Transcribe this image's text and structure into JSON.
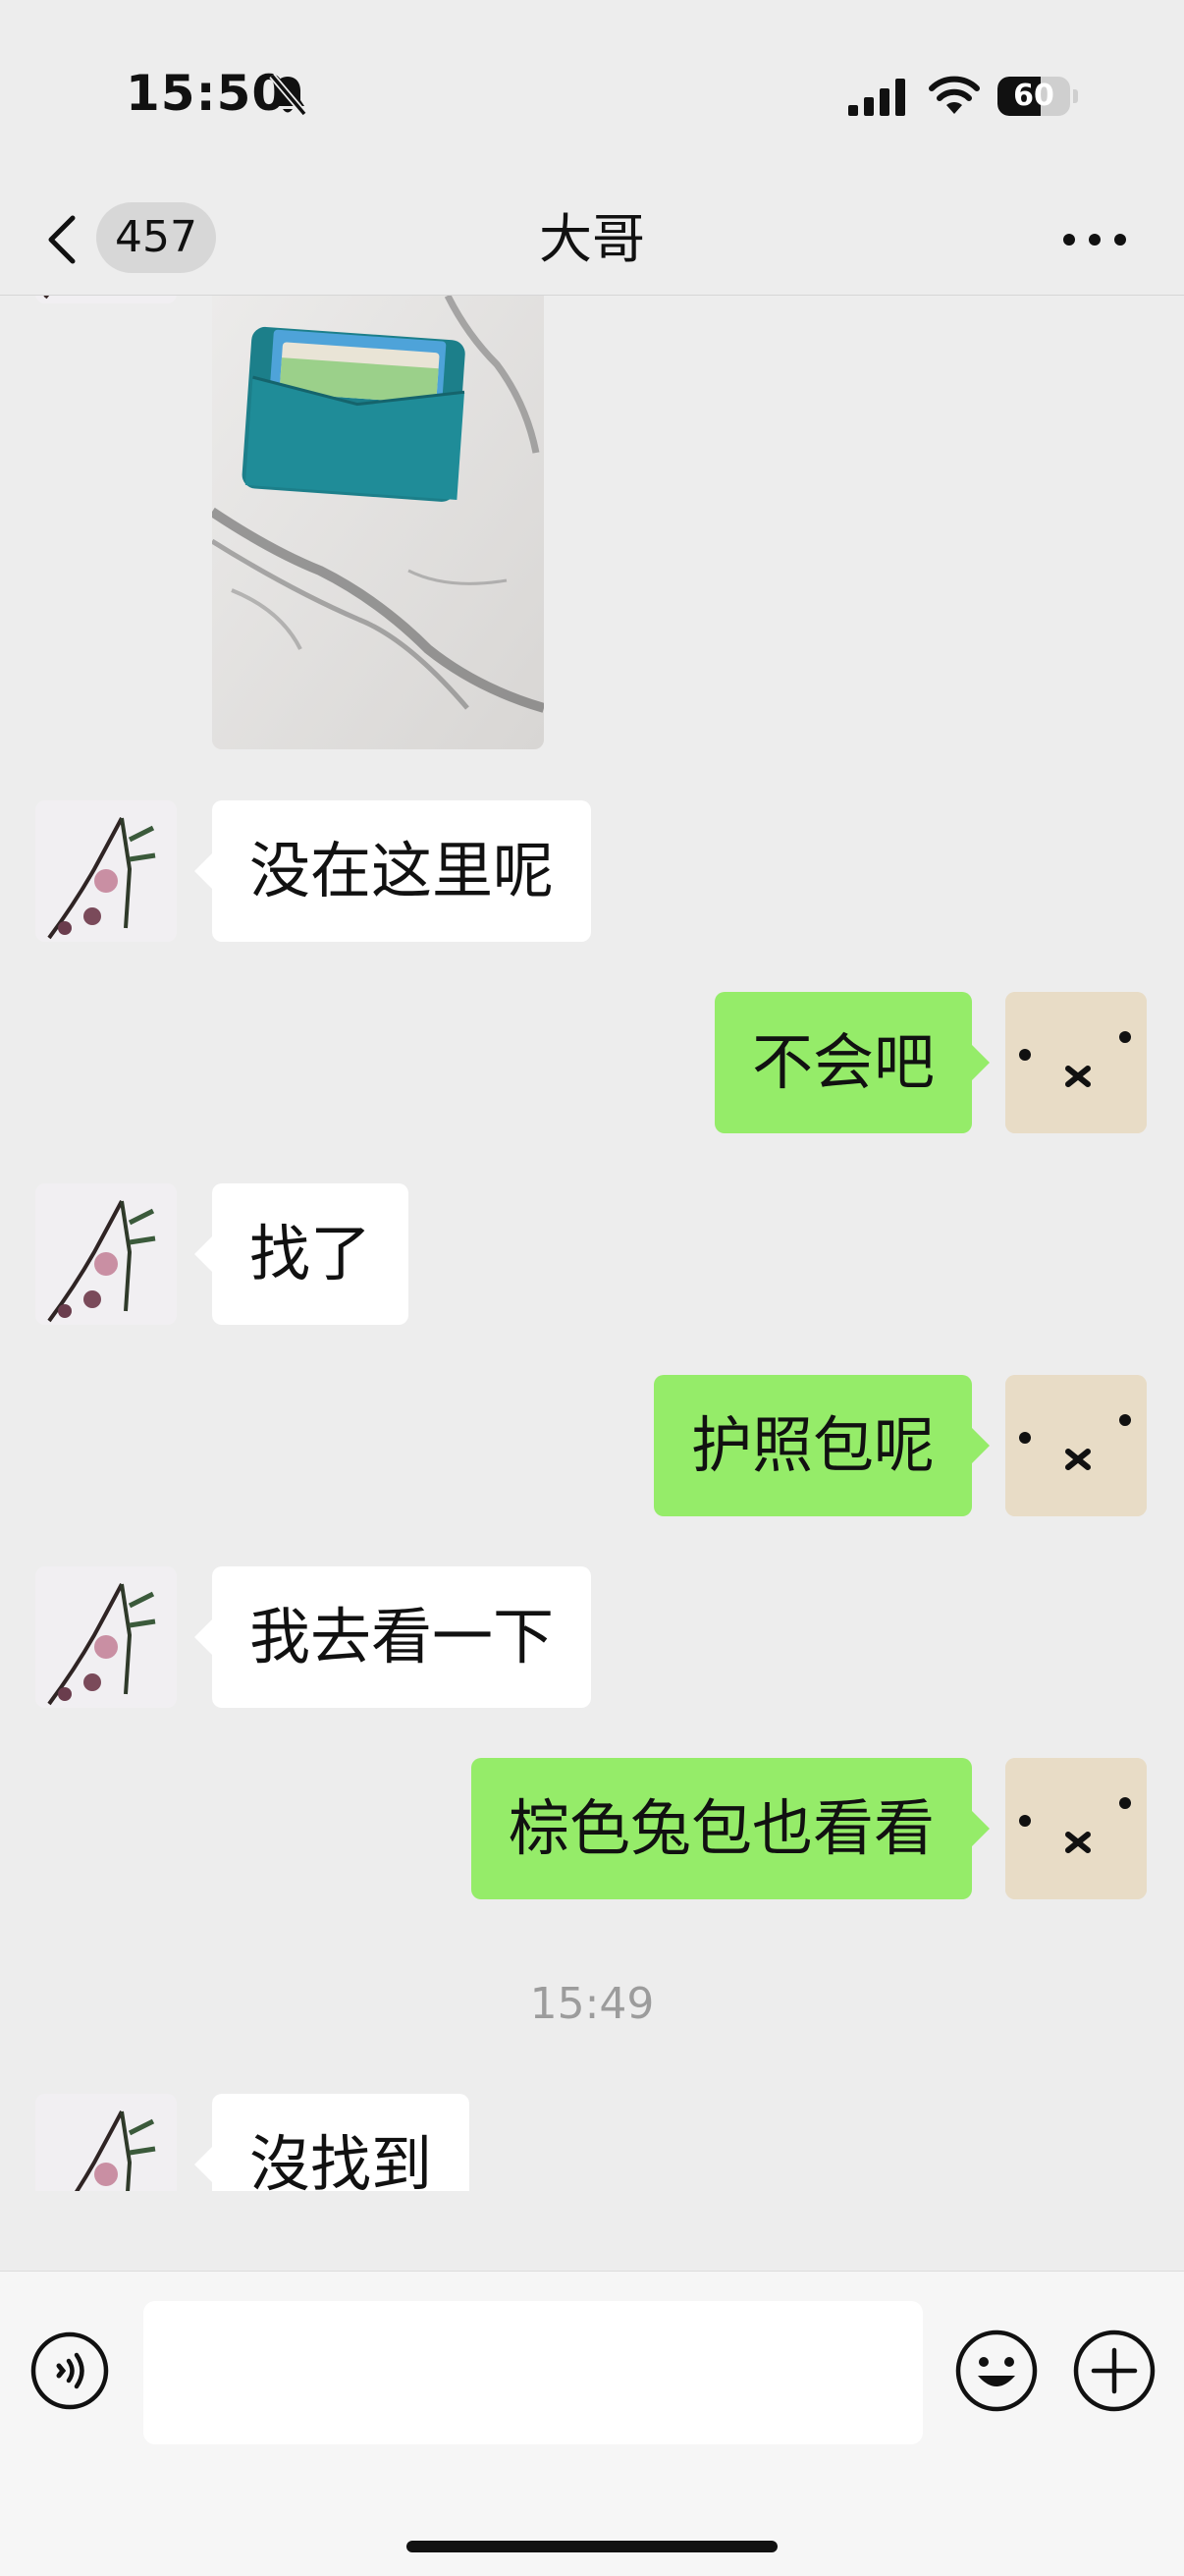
{
  "status_bar": {
    "time": "15:50",
    "battery": "60",
    "battery_level": 0.6
  },
  "header": {
    "unread_count": "457",
    "title": "大哥"
  },
  "messages": [
    {
      "from": "them",
      "type": "image",
      "alt": "teal card holder wallet on marble"
    },
    {
      "from": "them",
      "type": "text",
      "text": "没在这里呢"
    },
    {
      "from": "me",
      "type": "text",
      "text": "不会吧"
    },
    {
      "from": "them",
      "type": "text",
      "text": "找了"
    },
    {
      "from": "me",
      "type": "text",
      "text": "护照包呢"
    },
    {
      "from": "them",
      "type": "text",
      "text": "我去看一下"
    },
    {
      "from": "me",
      "type": "text",
      "text": "棕色兔包也看看"
    },
    {
      "type": "timestamp",
      "text": "15:49"
    },
    {
      "from": "them",
      "type": "text",
      "text": "沒找到"
    }
  ],
  "input": {
    "value": "",
    "placeholder": ""
  },
  "icons": {
    "back": "chevron-left-icon",
    "more": "more-dots-icon",
    "voice": "voice-icon",
    "emoji": "emoji-icon",
    "plus": "plus-icon",
    "mute": "bell-slash-icon"
  },
  "colors": {
    "background": "#ededed",
    "my_bubble": "#95ec69",
    "their_bubble": "#ffffff"
  }
}
